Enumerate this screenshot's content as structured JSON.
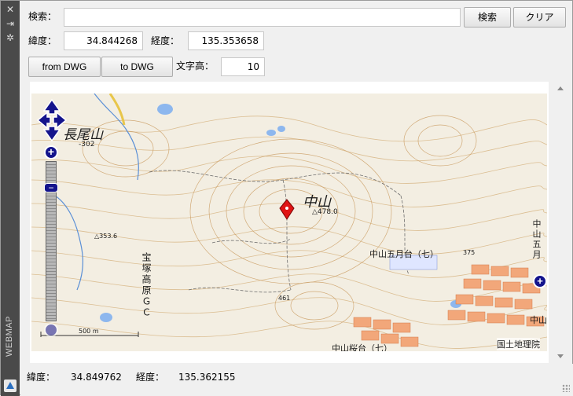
{
  "palette": {
    "title": "WEBMAP",
    "close_icon": "close-icon",
    "pin_icon": "autohide-icon",
    "settings_icon": "properties-icon"
  },
  "search": {
    "label": "検索：",
    "value": "",
    "search_button": "検索",
    "clear_button": "クリア"
  },
  "coords": {
    "lat_label": "緯度：",
    "lat_value": "34.844268",
    "lon_label": "経度：",
    "lon_value": "135.353658"
  },
  "actions": {
    "from_dwg": "from DWG",
    "to_dwg": "to DWG",
    "text_height_label": "文字高：",
    "text_height_value": "10"
  },
  "map": {
    "labels": {
      "nagaoyama": "長尾山",
      "nagaoyama_elev": "-302",
      "nakayama": "中山",
      "nakayama_elev": "△478.0",
      "elev_353": "△353.6",
      "takarazuka": "宝塚高原ＧＣ",
      "elev_461": "461",
      "elev_375": "375",
      "satsukidai": "中山五月台（七）",
      "sakuradai": "中山桜台（七）",
      "nakayama_edge": "中山五月",
      "nakayama_edge2": "中山",
      "attribution": "国土地理院",
      "scale": "500 m"
    },
    "controls": {
      "pan_icon": "pan-arrows-icon",
      "zoom_in": "+",
      "zoom_out": "−"
    },
    "marker_icon": "location-pin-icon"
  },
  "status": {
    "lat_label": "緯度：",
    "lat_value": "34.849762",
    "lon_label": "経度：",
    "lon_value": "135.362155"
  }
}
